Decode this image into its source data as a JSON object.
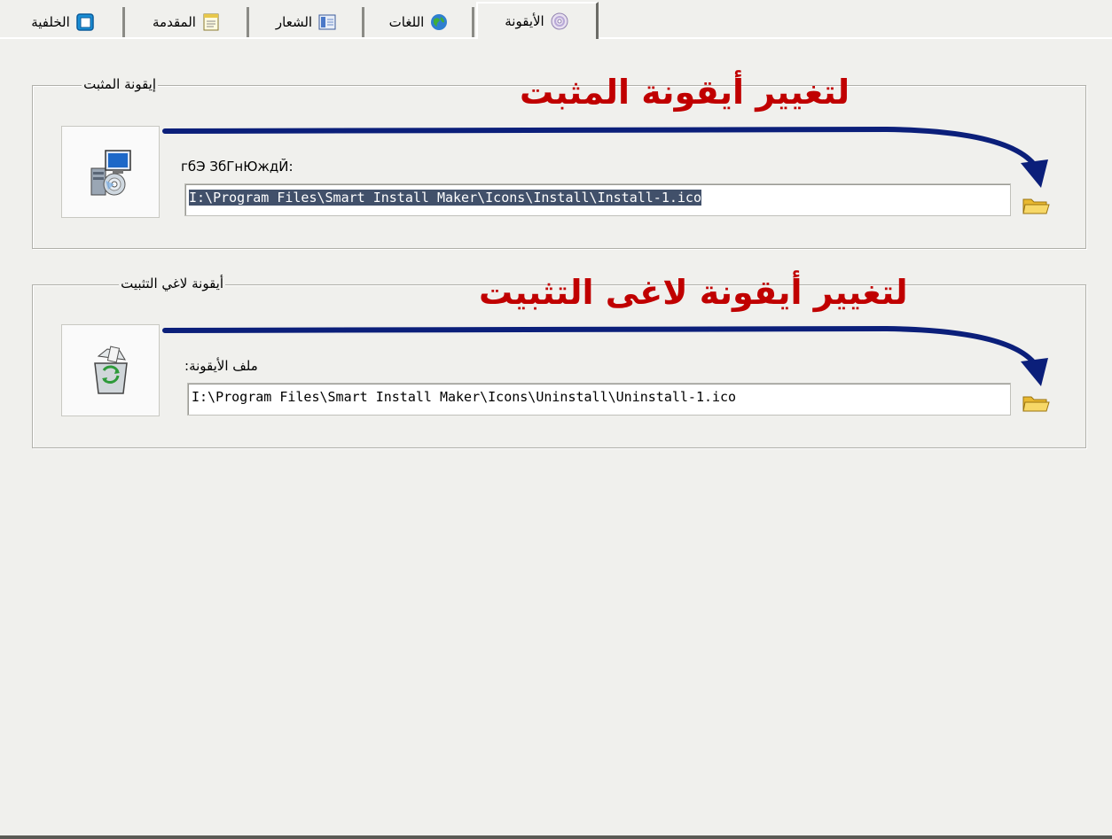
{
  "tabs": [
    {
      "label": "الخلفية",
      "icon": "window-icon"
    },
    {
      "label": "المقدمة",
      "icon": "notepad-icon"
    },
    {
      "label": "الشعار",
      "icon": "logo-panel-icon"
    },
    {
      "label": "اللغات",
      "icon": "globe-icon"
    },
    {
      "label": "الأيقونة",
      "icon": "cd-icon",
      "active": true
    }
  ],
  "installer_group": {
    "legend": "إيقونة المثبت",
    "annotation": "لتغيير أيقونة المثبت",
    "field_label": "гбЭ ЗбГнЮждЙ:",
    "field_value": "I:\\Program Files\\Smart Install Maker\\Icons\\Install\\Install-1.ico",
    "icon": "installer-icon",
    "browse_icon": "folder-icon"
  },
  "uninstaller_group": {
    "legend": "أيقونة لاغي التثبيت",
    "annotation": "لتغيير أيقونة لاغى التثبيت",
    "field_label": ":ملف الأيقونة",
    "field_value": "I:\\Program Files\\Smart Install Maker\\Icons\\Uninstall\\Uninstall-1.ico",
    "icon": "recycle-bin-icon",
    "browse_icon": "folder-icon"
  },
  "colors": {
    "annotation_text": "#c00000",
    "arrow": "#0b1f7a",
    "selection": "#41506a",
    "background": "#f0f0ed"
  }
}
